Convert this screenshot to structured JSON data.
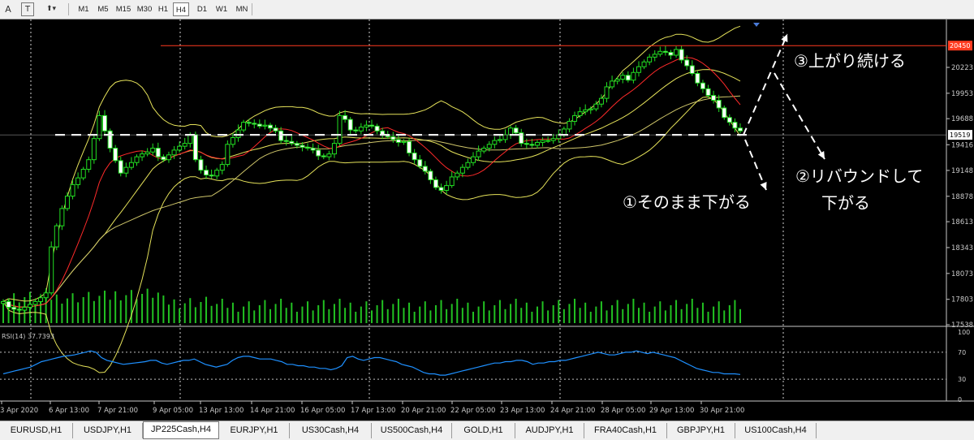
{
  "toolbar": {
    "tools": [
      {
        "label": "A",
        "name": "text-tool-icon"
      },
      {
        "label": "T",
        "name": "text-label-tool-icon"
      },
      {
        "label": "⬆▾",
        "name": "arrows-tool-icon"
      }
    ],
    "timeframes": [
      "M1",
      "M5",
      "M15",
      "M30",
      "H1",
      "H4",
      "D1",
      "W1",
      "MN"
    ],
    "active_timeframe": "H4"
  },
  "chart_data": {
    "type": "candlestick",
    "symbol": "JP225Cash,H4",
    "price_axis": {
      "labels": [
        "20223",
        "19953",
        "19688",
        "19519",
        "19416",
        "19148",
        "18878",
        "18613",
        "18343",
        "18073",
        "17803",
        "17538"
      ],
      "current_price": "19519",
      "top_marker": "20450"
    },
    "x_labels": [
      "3 Apr 2020",
      "6 Apr 13:00",
      "7 Apr 21:00",
      "9 Apr 05:00",
      "13 Apr 13:00",
      "14 Apr 21:00",
      "16 Apr 05:00",
      "17 Apr 13:00",
      "20 Apr 21:00",
      "22 Apr 05:00",
      "23 Apr 13:00",
      "24 Apr 21:00",
      "28 Apr 05:00",
      "29 Apr 13:00",
      "30 Apr 21:00"
    ],
    "closes": [
      17780,
      17720,
      17700,
      17690,
      17720,
      17750,
      17780,
      17820,
      17870,
      18350,
      18570,
      18750,
      18880,
      19000,
      19070,
      19160,
      19260,
      19480,
      19720,
      19560,
      19380,
      19250,
      19120,
      19180,
      19230,
      19290,
      19320,
      19340,
      19380,
      19290,
      19260,
      19310,
      19360,
      19400,
      19430,
      19520,
      19260,
      19150,
      19100,
      19090,
      19150,
      19210,
      19420,
      19490,
      19570,
      19650,
      19640,
      19630,
      19610,
      19620,
      19590,
      19560,
      19460,
      19450,
      19430,
      19410,
      19390,
      19380,
      19360,
      19300,
      19290,
      19320,
      19430,
      19720,
      19680,
      19570,
      19560,
      19600,
      19620,
      19610,
      19560,
      19520,
      19500,
      19470,
      19440,
      19450,
      19330,
      19260,
      19190,
      19140,
      19050,
      18970,
      18940,
      18990,
      19080,
      19120,
      19180,
      19230,
      19290,
      19350,
      19380,
      19420,
      19460,
      19470,
      19520,
      19590,
      19540,
      19430,
      19420,
      19410,
      19440,
      19460,
      19460,
      19480,
      19520,
      19580,
      19660,
      19720,
      19760,
      19780,
      19790,
      19840,
      19900,
      20020,
      20080,
      20100,
      20140,
      20090,
      20170,
      20230,
      20280,
      20330,
      20360,
      20390,
      20380,
      20350,
      20410,
      20300,
      20240,
      20160,
      20060,
      20000,
      19930,
      19880,
      19800,
      19700,
      19650,
      19590,
      19560
    ],
    "bollinger": {
      "upper": "upper band",
      "lower": "lower band"
    },
    "moving_averages": [
      "red",
      "yellow"
    ],
    "volume": true,
    "horizontal_lines": [
      {
        "kind": "resistance",
        "price": 20450,
        "color": "#ff3b1f"
      },
      {
        "kind": "support",
        "price": 19519,
        "color": "#ffffff"
      }
    ],
    "annotations": [
      "③上がり続ける",
      "②リバウンドして",
      "下がる",
      "①そのまま下がる"
    ],
    "rsi": {
      "label": "RSI(14) 37.7393",
      "axis_labels": [
        "100",
        "70",
        "30",
        "0"
      ],
      "levels": [
        70,
        30
      ],
      "values": [
        38,
        40,
        42,
        44,
        46,
        48,
        52,
        56,
        58,
        60,
        62,
        64,
        65,
        66,
        68,
        70,
        72,
        70,
        62,
        58,
        56,
        54,
        52,
        53,
        54,
        55,
        56,
        58,
        58,
        54,
        52,
        54,
        56,
        58,
        58,
        60,
        56,
        52,
        50,
        48,
        50,
        52,
        58,
        62,
        64,
        64,
        62,
        60,
        60,
        60,
        58,
        56,
        52,
        52,
        50,
        50,
        48,
        48,
        46,
        46,
        44,
        46,
        50,
        62,
        64,
        60,
        58,
        60,
        62,
        62,
        60,
        58,
        56,
        52,
        50,
        48,
        44,
        40,
        38,
        38,
        36,
        36,
        38,
        40,
        42,
        44,
        46,
        48,
        50,
        52,
        54,
        54,
        56,
        56,
        58,
        58,
        56,
        52,
        54,
        54,
        56,
        56,
        58,
        58,
        60,
        62,
        64,
        66,
        68,
        70,
        68,
        66,
        66,
        68,
        70,
        70,
        72,
        70,
        68,
        70,
        68,
        66,
        64,
        62,
        58,
        54,
        50,
        46,
        44,
        42,
        40,
        40,
        38,
        38,
        38,
        37
      ]
    }
  },
  "tabs": [
    "EURUSD,H1",
    "USDJPY,H1",
    "JP225Cash,H4",
    "EURJPY,H1",
    "US30Cash,H4",
    "US500Cash,H4",
    "GOLD,H1",
    "AUDJPY,H1",
    "FRA40Cash,H1",
    "GBPJPY,H1",
    "US100Cash,H4"
  ],
  "active_tab": "JP225Cash,H4"
}
